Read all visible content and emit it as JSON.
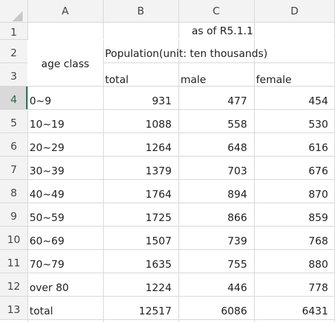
{
  "columns": [
    "A",
    "B",
    "C",
    "D"
  ],
  "row_numbers": [
    "1",
    "2",
    "3",
    "4",
    "5",
    "6",
    "7",
    "8",
    "9",
    "10",
    "11",
    "12",
    "13"
  ],
  "header": {
    "as_of": "as of R5.1.1",
    "population_label": "Population(unit: ten thousands)",
    "age_class": "age class",
    "total": "total",
    "male": "male",
    "female": "female"
  },
  "rows": [
    {
      "age": "0~9",
      "total": "931",
      "male": "477",
      "female": "454"
    },
    {
      "age": "10~19",
      "total": "1088",
      "male": "558",
      "female": "530"
    },
    {
      "age": "20~29",
      "total": "1264",
      "male": "648",
      "female": "616"
    },
    {
      "age": "30~39",
      "total": "1379",
      "male": "703",
      "female": "676"
    },
    {
      "age": "40~49",
      "total": "1764",
      "male": "894",
      "female": "870"
    },
    {
      "age": "50~59",
      "total": "1725",
      "male": "866",
      "female": "859"
    },
    {
      "age": "60~69",
      "total": "1507",
      "male": "739",
      "female": "768"
    },
    {
      "age": "70~79",
      "total": "1635",
      "male": "755",
      "female": "880"
    },
    {
      "age": "over 80",
      "total": "1224",
      "male": "446",
      "female": "778"
    },
    {
      "age": "total",
      "total": "12517",
      "male": "6086",
      "female": "6431"
    }
  ],
  "selected_row": "4",
  "colors": {
    "accent": "#217346",
    "gridline": "#d6d6d6",
    "header_bg": "#f3f3f3"
  }
}
